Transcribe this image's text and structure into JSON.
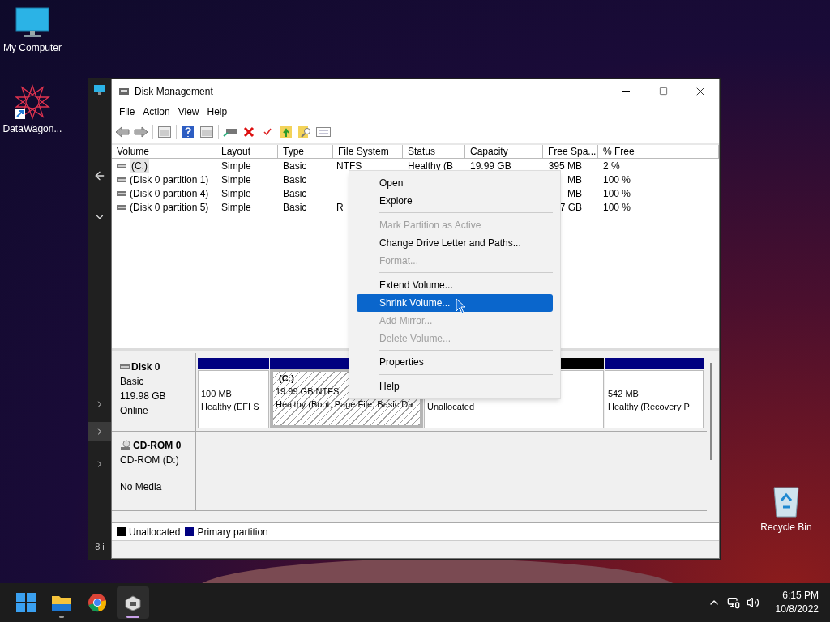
{
  "desktop_icons": [
    {
      "kind": "computer",
      "label": "My Computer"
    },
    {
      "kind": "shortcut",
      "label": "DataWagon..."
    },
    {
      "kind": "recycle",
      "label": "Recycle Bin"
    }
  ],
  "background_window": {
    "fragment": "8 i"
  },
  "window": {
    "title": "Disk Management",
    "menu": [
      "File",
      "Action",
      "View",
      "Help"
    ],
    "table": {
      "columns": [
        "Volume",
        "Layout",
        "Type",
        "File System",
        "Status",
        "Capacity",
        "Free Spa...",
        "% Free"
      ],
      "rows": [
        {
          "selected": true,
          "cells": [
            "(C:)",
            "Simple",
            "Basic",
            "NTFS",
            "Healthy (B",
            "19.99 GB",
            "395 MB",
            "2 %"
          ]
        },
        {
          "selected": false,
          "cells": [
            "(Disk 0 partition 1)",
            "Simple",
            "Basic",
            "",
            "",
            "",
            "MB",
            "100 %"
          ]
        },
        {
          "selected": false,
          "cells": [
            "(Disk 0 partition 4)",
            "Simple",
            "Basic",
            "",
            "",
            "",
            "MB",
            "100 %"
          ]
        },
        {
          "selected": false,
          "cells": [
            "(Disk 0 partition 5)",
            "Simple",
            "Basic",
            "R",
            "",
            "",
            "7 GB",
            "100 %"
          ]
        }
      ]
    },
    "disks": [
      {
        "kind": "disk",
        "name": "Disk 0",
        "lines": [
          "Basic",
          "119.98 GB",
          "Online"
        ],
        "partitions": [
          {
            "color": "#000080",
            "selected": false,
            "lines": [
              "100 MB",
              "Healthy (EFI S"
            ]
          },
          {
            "color": "#000080",
            "selected": true,
            "lines": [
              "(C:)",
              "19.99 GB NTFS",
              "Healthy (Boot, Page File, Basic Da"
            ]
          },
          {
            "color": "#000000",
            "selected": false,
            "lines": [
              "Unallocated"
            ]
          },
          {
            "color": "#000080",
            "selected": false,
            "lines": [
              "542 MB",
              "Healthy (Recovery P"
            ]
          }
        ]
      },
      {
        "kind": "cdrom",
        "name": "CD-ROM 0",
        "lines": [
          "CD-ROM (D:)",
          "No Media"
        ]
      }
    ],
    "legend": [
      {
        "label": "Unallocated",
        "color": "#000000"
      },
      {
        "label": "Primary partition",
        "color": "#000080"
      }
    ]
  },
  "context_menu": {
    "items": [
      {
        "kind": "item",
        "label": "Open",
        "disabled": false,
        "selected": false
      },
      {
        "kind": "item",
        "label": "Explore",
        "disabled": false,
        "selected": false
      },
      {
        "kind": "separator"
      },
      {
        "kind": "item",
        "label": "Mark Partition as Active",
        "disabled": true,
        "selected": false
      },
      {
        "kind": "item",
        "label": "Change Drive Letter and Paths...",
        "disabled": false,
        "selected": false
      },
      {
        "kind": "item",
        "label": "Format...",
        "disabled": true,
        "selected": false
      },
      {
        "kind": "separator"
      },
      {
        "kind": "item",
        "label": "Extend Volume...",
        "disabled": false,
        "selected": false
      },
      {
        "kind": "item",
        "label": "Shrink Volume...",
        "disabled": false,
        "selected": true
      },
      {
        "kind": "item",
        "label": "Add Mirror...",
        "disabled": true,
        "selected": false
      },
      {
        "kind": "item",
        "label": "Delete Volume...",
        "disabled": true,
        "selected": false
      },
      {
        "kind": "separator"
      },
      {
        "kind": "item",
        "label": "Properties",
        "disabled": false,
        "selected": false
      },
      {
        "kind": "separator"
      },
      {
        "kind": "item",
        "label": "Help",
        "disabled": false,
        "selected": false
      }
    ]
  },
  "taskbar": {
    "apps": [
      {
        "kind": "start",
        "running": false,
        "active": false
      },
      {
        "kind": "explorer",
        "running": true,
        "active": false
      },
      {
        "kind": "browser",
        "running": false,
        "active": false
      },
      {
        "kind": "disk-tool",
        "running": true,
        "active": true
      }
    ],
    "time": "6:15 PM",
    "date": "10/8/2022"
  }
}
